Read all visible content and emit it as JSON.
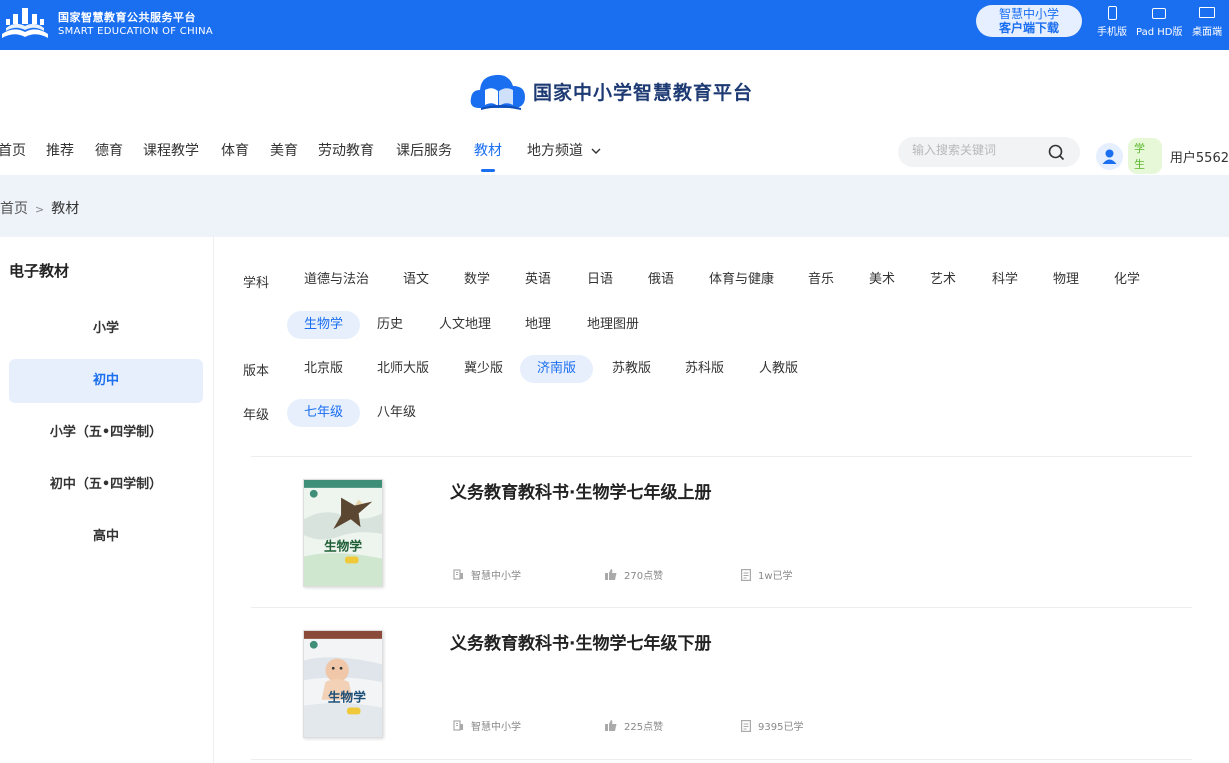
{
  "brand": {
    "cn": "国家智慧教育公共服务平台",
    "en": "SMART EDUCATION OF CHINA"
  },
  "client_download": {
    "line1": "智慧中小学",
    "line2": "客户端下载"
  },
  "devices": [
    {
      "label": "手机版",
      "icon": "phone-icon"
    },
    {
      "label": "Pad HD版",
      "icon": "tablet-icon"
    },
    {
      "label": "桌面端",
      "icon": "desktop-icon"
    }
  ],
  "site_title": "国家中小学智慧教育平台",
  "nav": {
    "items": [
      "首页",
      "推荐",
      "德育",
      "课程教学",
      "体育",
      "美育",
      "劳动教育",
      "课后服务",
      "教材",
      "地方频道"
    ],
    "active": "教材"
  },
  "search": {
    "placeholder": "输入搜索关键词"
  },
  "user": {
    "role": "学生",
    "name": "用户5562"
  },
  "breadcrumb": {
    "home": "首页",
    "sep": ">",
    "current": "教材"
  },
  "sidebar": {
    "title": "电子教材",
    "items": [
      "小学",
      "初中",
      "小学（五•四学制）",
      "初中（五•四学制）",
      "高中"
    ],
    "active": "初中"
  },
  "filters": {
    "subject": {
      "label": "学科",
      "row1": [
        "道德与法治",
        "语文",
        "数学",
        "英语",
        "日语",
        "俄语",
        "体育与健康",
        "音乐",
        "美术",
        "艺术",
        "科学",
        "物理",
        "化学"
      ],
      "row2": [
        "生物学",
        "历史",
        "人文地理",
        "地理",
        "地理图册"
      ],
      "active": "生物学"
    },
    "edition": {
      "label": "版本",
      "options": [
        "北京版",
        "北师大版",
        "冀少版",
        "济南版",
        "苏教版",
        "苏科版",
        "人教版"
      ],
      "active": "济南版"
    },
    "grade": {
      "label": "年级",
      "options": [
        "七年级",
        "八年级"
      ],
      "active": "七年级"
    }
  },
  "books": [
    {
      "title": "义务教育教科书·生物学七年级上册",
      "publisher": "智慧中小学",
      "likes": "270点赞",
      "learners": "1w已学",
      "cover_text": "生物学"
    },
    {
      "title": "义务教育教科书·生物学七年级下册",
      "publisher": "智慧中小学",
      "likes": "225点赞",
      "learners": "9395已学",
      "cover_text": "生物学"
    }
  ],
  "colors": {
    "brand_blue": "#1a6ef0",
    "active_bg": "#e7effd",
    "band_bg": "#eef2f9"
  }
}
